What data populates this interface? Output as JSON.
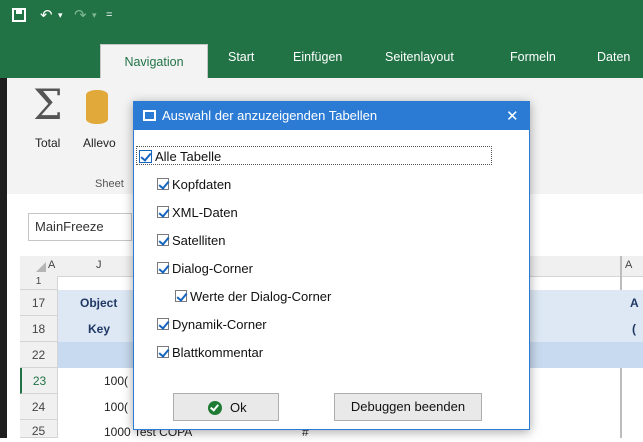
{
  "quick_access": {
    "save_icon": "save-icon",
    "undo_icon": "undo-icon",
    "redo_icon": "redo-icon"
  },
  "tabs": [
    "Navigation",
    "Start",
    "Einfügen",
    "Seitenlayout",
    "Formeln",
    "Daten"
  ],
  "ribbon": {
    "btn_total": "Total",
    "btn_allevo": "Allevo",
    "group_label": "Sheet"
  },
  "namebox": {
    "value": "MainFreeze"
  },
  "grid": {
    "col_labels": [
      "A",
      "J"
    ],
    "right_col_label": "A",
    "right_cell_label": "(",
    "rows": [
      {
        "num": "17",
        "cell": "Object"
      },
      {
        "num": "18",
        "cell": "Key"
      },
      {
        "num": "22",
        "cell": ""
      },
      {
        "num": "23",
        "cell": "100("
      },
      {
        "num": "24",
        "cell": "100("
      },
      {
        "num": "25",
        "cell": "1000 Test COPA"
      }
    ],
    "partial_row": "1",
    "hash_cell": "#"
  },
  "dialog": {
    "title": "Auswahl der anzuzeigenden Tabellen",
    "close": "✕",
    "items": [
      {
        "label": "Alle Tabelle",
        "checked": true
      },
      {
        "label": "Kopfdaten",
        "checked": true
      },
      {
        "label": "XML-Daten",
        "checked": true
      },
      {
        "label": "Satelliten",
        "checked": true
      },
      {
        "label": "Dialog-Corner",
        "checked": true
      },
      {
        "label": "Werte der Dialog-Corner",
        "checked": true
      },
      {
        "label": "Dynamik-Corner",
        "checked": true
      },
      {
        "label": "Blattkommentar",
        "checked": true
      }
    ],
    "ok_label": "Ok",
    "debug_label": "Debuggen beenden"
  },
  "colors": {
    "excel_green": "#217346",
    "dialog_blue": "#2b7bd5",
    "check_blue": "#1565c0",
    "ok_green": "#1e7b34"
  }
}
